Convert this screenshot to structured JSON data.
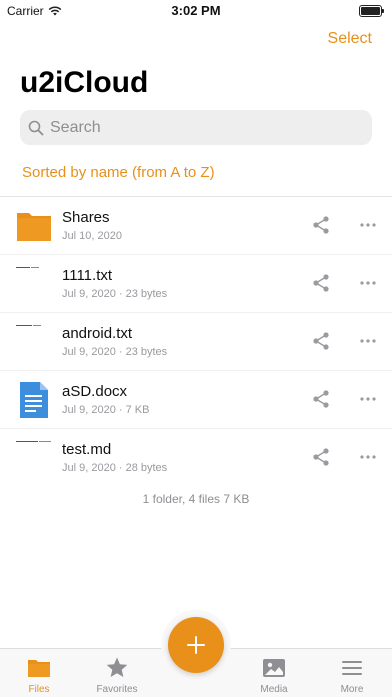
{
  "status_bar": {
    "carrier": "Carrier",
    "time": "3:02 PM"
  },
  "header": {
    "select_label": "Select",
    "title": "u2iCloud"
  },
  "search": {
    "placeholder": "Search"
  },
  "sort": {
    "label": "Sorted by name (from A to Z)"
  },
  "files": [
    {
      "name": "Shares",
      "meta": "Jul 10, 2020",
      "icon": "folder-icon"
    },
    {
      "name": "1111.txt",
      "meta": "Jul 9, 2020 · 23 bytes",
      "icon": "text-file-thumbnail"
    },
    {
      "name": "android.txt",
      "meta": "Jul 9, 2020 · 23 bytes",
      "icon": "text-file-thumbnail"
    },
    {
      "name": "aSD.docx",
      "meta": "Jul 9, 2020 · 7 KB",
      "icon": "document-icon"
    },
    {
      "name": "test.md",
      "meta": "Jul 9, 2020 · 28 bytes",
      "icon": "markdown-file-thumbnail"
    }
  ],
  "summary": "1 folder, 4 files 7 KB",
  "tabs": [
    {
      "label": "Files",
      "icon": "folder-icon",
      "active": true
    },
    {
      "label": "Favorites",
      "icon": "star-icon",
      "active": false
    },
    {
      "label": "Media",
      "icon": "image-icon",
      "active": false
    },
    {
      "label": "More",
      "icon": "menu-icon",
      "active": false
    }
  ],
  "colors": {
    "accent": "#E8901A",
    "doc_blue": "#3E8EDE",
    "secondary_text": "#8E8E93"
  }
}
